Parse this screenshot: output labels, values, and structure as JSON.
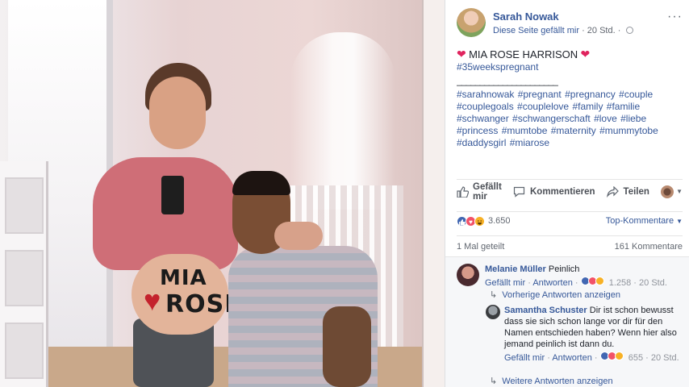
{
  "post_header": {
    "author": "Sarah Nowak",
    "page_like": "Diese Seite gefällt mir",
    "separator": "·",
    "time": "20 Std.",
    "more_icon": "more-options-icon",
    "visibility_icon": "globe-icon"
  },
  "post_body": {
    "heart": "❤",
    "title": "MIA ROSE HARRISON",
    "hashtag_main": "#35weekspregnant",
    "separator_line": "______________________",
    "hashtags": "#sarahnowak #pregnant #pregnancy #couple #couplegoals #couplelove #family #familie #schwanger #schwangerschaft #love #liebe #princess #mumtobe #maternity #mummytobe #daddysgirl #miarose"
  },
  "photo": {
    "belly_line1": "MIA",
    "belly_line2": "ROSE",
    "belly_heart": "♥"
  },
  "actions": {
    "like": "Gefällt mir",
    "comment": "Kommentieren",
    "share": "Teilen",
    "like_icon": "thumbs-up-icon",
    "comment_icon": "comment-bubble-icon",
    "share_icon": "share-arrow-icon",
    "caret": "▼"
  },
  "reactions": {
    "count": "3.650",
    "sort_label": "Top-Kommentare",
    "sort_caret": "▼",
    "types": [
      "like",
      "love",
      "haha"
    ],
    "like_glyph": "👍",
    "love_glyph": "♥",
    "haha_glyph": "😆"
  },
  "stats": {
    "shares": "1 Mal geteilt",
    "comments": "161 Kommentare"
  },
  "comments": {
    "c1": {
      "name": "Melanie Müller",
      "text": "Peinlich",
      "like": "Gefällt mir",
      "reply": "Antworten",
      "dot": "·",
      "count": "1.258",
      "time": "20 Std."
    },
    "previous_replies": "Vorherige Antworten anzeigen",
    "reply_arrow": "↳",
    "c2": {
      "name": "Samantha Schuster",
      "text": "Dir ist schon bewusst dass sie sich schon lange vor dir für den Namen entschieden haben? Wenn hier also jemand peinlich ist dann du.",
      "like": "Gefällt mir",
      "reply": "Antworten",
      "dot": "·",
      "count": "655",
      "time": "20 Std."
    },
    "more_replies": "Weitere Antworten anzeigen"
  },
  "colors": {
    "link_blue": "#365899",
    "like_blue": "#4267b2",
    "love_red": "#f25268",
    "haha_yellow": "#f7b125",
    "panel_bg": "#ffffff",
    "comments_bg": "#f6f7f9"
  }
}
